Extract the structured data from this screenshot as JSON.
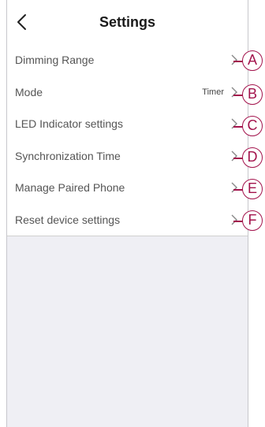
{
  "header": {
    "title": "Settings",
    "back_icon": "chevron-left-icon"
  },
  "settings": [
    {
      "label": "Dimming Range",
      "value": "",
      "badge": "A"
    },
    {
      "label": "Mode",
      "value": "Timer",
      "badge": "B"
    },
    {
      "label": "LED Indicator settings",
      "value": "",
      "badge": "C"
    },
    {
      "label": "Synchronization Time",
      "value": "",
      "badge": "D"
    },
    {
      "label": "Manage Paired Phone",
      "value": "",
      "badge": "E"
    },
    {
      "label": "Reset device settings",
      "value": "",
      "badge": "F"
    }
  ],
  "colors": {
    "accent": "#a3134c",
    "background": "#efeff4"
  }
}
